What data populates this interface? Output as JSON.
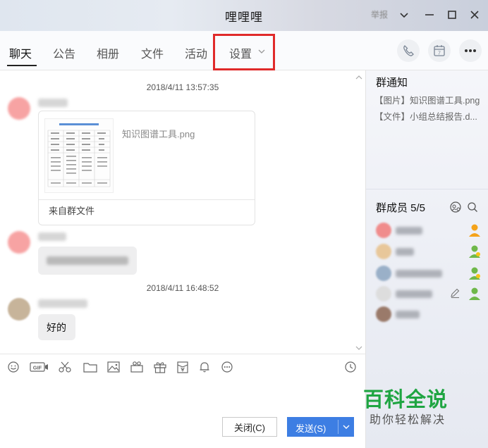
{
  "window": {
    "title": "哩哩哩",
    "menu_label": "举报",
    "controls": [
      "chevron-down-icon",
      "minimize-icon",
      "maximize-icon",
      "close-icon"
    ]
  },
  "tabs": [
    {
      "label": "聊天",
      "active": true
    },
    {
      "label": "公告",
      "active": false
    },
    {
      "label": "相册",
      "active": false
    },
    {
      "label": "文件",
      "active": false
    },
    {
      "label": "活动",
      "active": false
    },
    {
      "label": "设置",
      "active": false
    }
  ],
  "header_actions": [
    "phone-icon",
    "calendar-icon",
    "more-icon"
  ],
  "calendar_day": "7",
  "messages": [
    {
      "timestamp": "2018/4/11 13:57:35"
    },
    {
      "type": "file",
      "file_name": "知识图谱工具.png",
      "source": "来自群文件"
    },
    {
      "type": "text-blurred"
    },
    {
      "timestamp": "2018/4/11 16:48:52"
    },
    {
      "type": "text",
      "text": "好的"
    }
  ],
  "toolbar": {
    "icons": [
      "emoji-icon",
      "gif-icon",
      "scissors-icon",
      "folder-icon",
      "image-icon",
      "screen-share-icon",
      "gift-icon",
      "red-packet-icon",
      "bell-icon",
      "more-circle-icon",
      "history-clock-icon"
    ],
    "gif_label": "GIF"
  },
  "buttons": {
    "close_label": "关闭(C)",
    "send_label": "发送(S)"
  },
  "right_panel": {
    "notice_title": "群通知",
    "notices": [
      "【图片】知识图谱工具.png",
      "【文件】小组总结报告.d..."
    ],
    "members_title": "群成员 5/5",
    "members": [
      {
        "avatar_color": "#f08c8c",
        "role_color": "#f5a31a"
      },
      {
        "avatar_color": "#e8c79a",
        "role_color": "#6fb84a"
      },
      {
        "avatar_color": "#9ab0c8",
        "role_color": "#6fb84a"
      },
      {
        "avatar_color": "#dddddd",
        "role_color": "#6fb84a"
      },
      {
        "avatar_color": "#9a7a6a",
        "role_color": ""
      }
    ]
  },
  "watermark": {
    "main": "百科全说",
    "sub": "助你轻松解决"
  },
  "colors": {
    "accent_blue": "#3d7ee3",
    "highlight_red": "#e02a2a",
    "watermark_green": "#1fa542"
  }
}
